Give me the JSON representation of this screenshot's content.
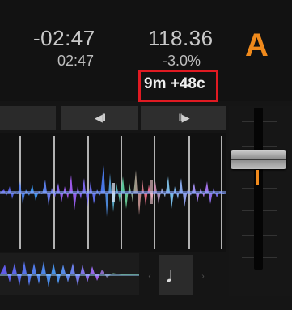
{
  "deck": {
    "time_remaining": "-02:47",
    "time_elapsed": "02:47",
    "bpm": "118.36",
    "pitch_percent": "-3.0%",
    "letter": "A",
    "key_offset": "9m +48c"
  },
  "controls": {
    "beatjump_back_icon": "skip-back-icon",
    "beatjump_back_glyph": "◀‖",
    "beatjump_forward_icon": "skip-forward-icon",
    "beatjump_forward_glyph": "‖▶",
    "note_icon": "music-note-icon",
    "note_glyph": "♩",
    "nav_left_glyph": "‹",
    "nav_right_glyph": "›"
  },
  "tempo_fader": {
    "position": 0.28
  },
  "colors": {
    "accent": "#f08a1c",
    "highlight_box": "#e01a22",
    "text": "#c9c9c9"
  }
}
